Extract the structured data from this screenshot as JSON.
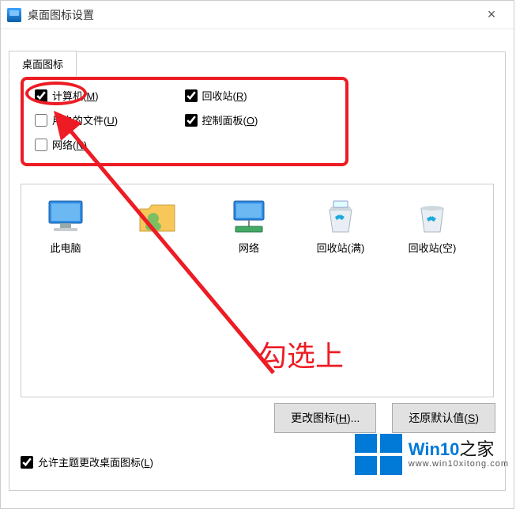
{
  "window": {
    "title": "桌面图标设置",
    "close": "×"
  },
  "tab": {
    "label": "桌面图标"
  },
  "fieldset": {
    "legend": "桌面图标"
  },
  "checkboxes": {
    "computer": {
      "label": "计算机(",
      "hotkey": "M",
      "suffix": ")",
      "checked": true
    },
    "recycle": {
      "label": "回收站(",
      "hotkey": "R",
      "suffix": ")",
      "checked": true
    },
    "userfiles": {
      "label": "用户的文件(",
      "hotkey": "U",
      "suffix": ")",
      "checked": false
    },
    "controlpanel": {
      "label": "控制面板(",
      "hotkey": "O",
      "suffix": ")",
      "checked": true
    },
    "network": {
      "label": "网络(",
      "hotkey": "N",
      "suffix": ")",
      "checked": false
    }
  },
  "icons": {
    "thispc": {
      "label": "此电脑"
    },
    "user": {
      "label": ""
    },
    "network": {
      "label": "网络"
    },
    "bin_full": {
      "label": "回收站(满)"
    },
    "bin_empty": {
      "label": "回收站(空)"
    }
  },
  "buttons": {
    "change": {
      "label": "更改图标(",
      "hotkey": "H",
      "suffix": ")..."
    },
    "restore": {
      "label": "还原默认值(",
      "hotkey": "S",
      "suffix": ")"
    }
  },
  "allow_theme": {
    "label": "允许主题更改桌面图标(",
    "hotkey": "L",
    "suffix": ")",
    "checked": true
  },
  "annotation": {
    "text": "勾选上"
  },
  "logo": {
    "brand_prefix": "Win10",
    "brand_suffix": "之家",
    "url": "www.win10xitong.com"
  }
}
